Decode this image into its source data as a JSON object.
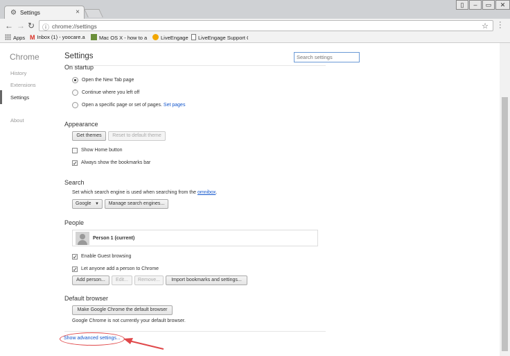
{
  "browser": {
    "tab_title": "Settings",
    "url": "chrome://settings"
  },
  "bookmarks": [
    {
      "label": "Apps",
      "icon": "apps-grid-icon",
      "color": "#7a7a7a"
    },
    {
      "label": "Inbox (1) - yoocare.a",
      "icon": "gmail-icon",
      "color": "#d93025"
    },
    {
      "label": "Mac OS X - how to a",
      "icon": "page-icon",
      "color": "#6a8f3a"
    },
    {
      "label": "LiveEngage",
      "icon": "liveengage-icon",
      "color": "#f2a700"
    },
    {
      "label": "LiveEngage Support C",
      "icon": "document-icon",
      "color": "#777777"
    }
  ],
  "sidebar": {
    "title": "Chrome",
    "items": [
      "History",
      "Extensions",
      "Settings",
      "About"
    ]
  },
  "header": {
    "title": "Settings",
    "search_placeholder": "Search settings"
  },
  "startup": {
    "title": "On startup",
    "options": [
      {
        "label": "Open the New Tab page",
        "selected": true
      },
      {
        "label": "Continue where you left off",
        "selected": false
      },
      {
        "label": "Open a specific page or set of pages.",
        "selected": false,
        "link": "Set pages"
      }
    ]
  },
  "appearance": {
    "title": "Appearance",
    "get_themes": "Get themes",
    "reset_theme": "Reset to default theme",
    "show_home": "Show Home button",
    "show_bookmarks": "Always show the bookmarks bar"
  },
  "search": {
    "title": "Search",
    "description": "Set which search engine is used when searching from the",
    "link": "omnibox",
    "engine": "Google",
    "manage": "Manage search engines..."
  },
  "people": {
    "title": "People",
    "person": "Person 1 (current)",
    "guest": "Enable Guest browsing",
    "anyone_add": "Let anyone add a person to Chrome",
    "add": "Add person...",
    "edit": "Edit...",
    "remove": "Remove...",
    "import": "Import bookmarks and settings..."
  },
  "default_browser": {
    "title": "Default browser",
    "make_default": "Make Google Chrome the default browser",
    "status": "Google Chrome is not currently your default browser."
  },
  "advanced_link": "Show advanced settings...",
  "accent_color": "#1155cc",
  "annotation_color": "#e0484a"
}
